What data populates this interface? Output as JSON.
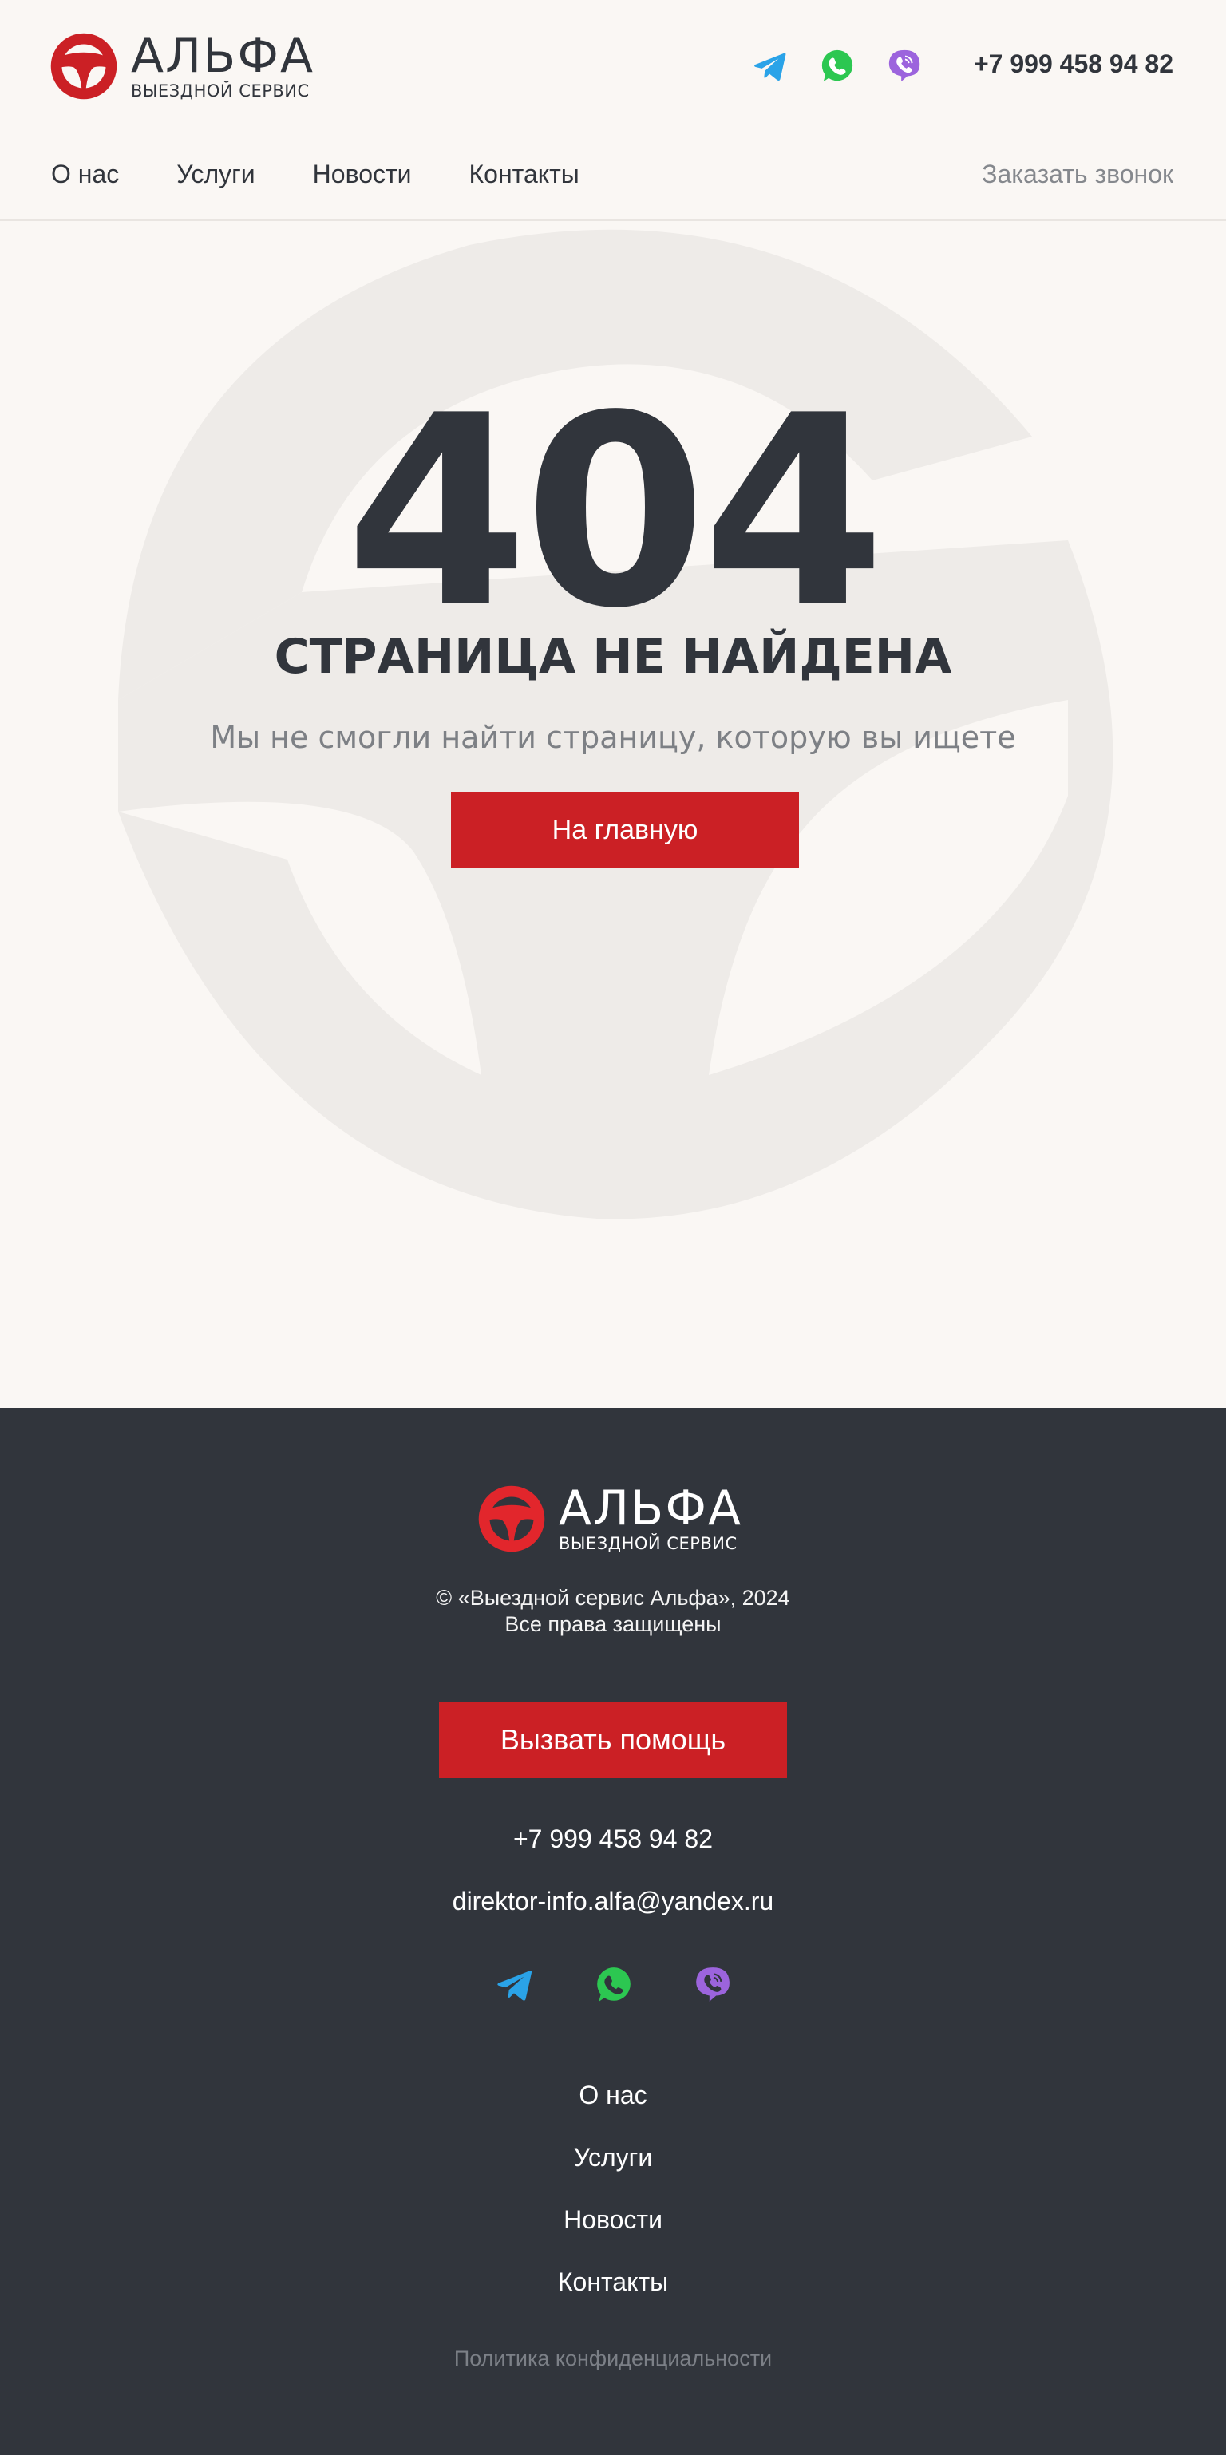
{
  "brand": {
    "name": "АЛЬФА",
    "subtitle": "ВЫЕЗДНОЙ СЕРВИС",
    "icon": "steering-wheel-icon",
    "accent_color": "#cb2025"
  },
  "header": {
    "phone": "+7 999 458 94 82",
    "callback_label": "Заказать звонок",
    "social": [
      {
        "name": "telegram-icon",
        "color": "#2aa3e8"
      },
      {
        "name": "whatsapp-icon",
        "color": "#2cc751"
      },
      {
        "name": "viber-icon",
        "color": "#9c64dd"
      }
    ],
    "nav": [
      {
        "label": "О нас"
      },
      {
        "label": "Услуги"
      },
      {
        "label": "Новости"
      },
      {
        "label": "Контакты"
      }
    ]
  },
  "main": {
    "code": "404",
    "title": "СТРАНИЦА НЕ НАЙДЕНА",
    "description": "Мы не смогли найти страницу, которую вы ищете",
    "home_button": "На главную"
  },
  "footer": {
    "copyright_line1": "© «Выездной сервис Альфа», 2024",
    "copyright_line2": "Все права защищены",
    "help_button": "Вызвать помощь",
    "phone": "+7 999 458 94 82",
    "email": "direktor-info.alfa@yandex.ru",
    "nav": [
      {
        "label": "О нас"
      },
      {
        "label": "Услуги"
      },
      {
        "label": "Новости"
      },
      {
        "label": "Контакты"
      }
    ],
    "privacy": "Политика конфиденциальности",
    "background_color": "#31353c"
  }
}
